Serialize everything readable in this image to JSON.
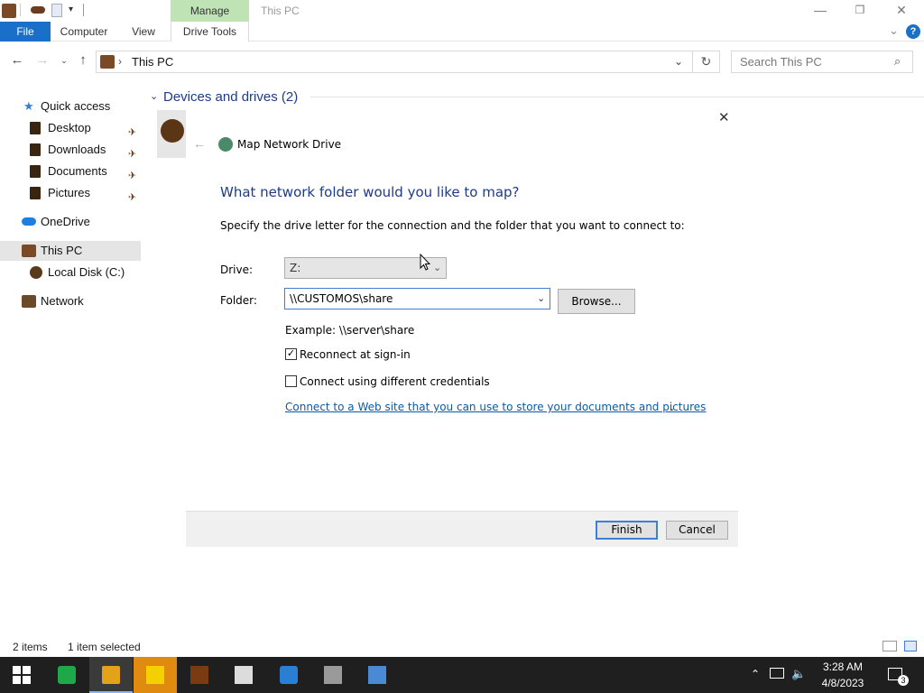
{
  "window": {
    "title": "This PC",
    "context_tab": "Manage",
    "minimize_glyph": "—",
    "maximize_glyph": "❐",
    "close_glyph": "✕"
  },
  "ribbon": {
    "tabs": [
      "File",
      "Computer",
      "View",
      "Drive Tools"
    ],
    "help_glyph": "?",
    "expand_glyph": "⌄"
  },
  "address": {
    "path": "This PC",
    "separator": "›",
    "search_placeholder": "Search This PC"
  },
  "nav": {
    "items": [
      {
        "label": "Quick access"
      },
      {
        "label": "Desktop"
      },
      {
        "label": "Downloads"
      },
      {
        "label": "Documents"
      },
      {
        "label": "Pictures"
      },
      {
        "label": "OneDrive"
      },
      {
        "label": "This PC"
      },
      {
        "label": "Local Disk (C:)"
      },
      {
        "label": "Network"
      }
    ]
  },
  "content": {
    "group_header": "Devices and drives (2)"
  },
  "status": {
    "items_count": "2 items",
    "selection": "1 item selected"
  },
  "dialog": {
    "title": "Map Network Drive",
    "heading": "What network folder would you like to map?",
    "instruction": "Specify the drive letter for the connection and the folder that you want to connect to:",
    "drive_label": "Drive:",
    "drive_value": "Z:",
    "folder_label": "Folder:",
    "folder_value": "\\\\CUSTOMOS\\share",
    "browse_label": "Browse...",
    "example": "Example: \\\\server\\share",
    "reconnect_label": "Reconnect at sign-in",
    "reconnect_checked": true,
    "credentials_label": "Connect using different credentials",
    "credentials_checked": false,
    "website_link_text": "Connect to a Web site that you can use to store your documents and pictures",
    "website_link_suffix": ".",
    "finish_label": "Finish",
    "cancel_label": "Cancel"
  },
  "taskbar": {
    "time": "3:28 AM",
    "date": "4/8/2023",
    "notification_count": "3"
  },
  "colors": {
    "accent": "#1a6fc9",
    "heading_blue": "#1e3a8a",
    "link_blue": "#0a5aa8",
    "context_green": "#bfe3b5",
    "taskbar": "#1f1f1f"
  }
}
